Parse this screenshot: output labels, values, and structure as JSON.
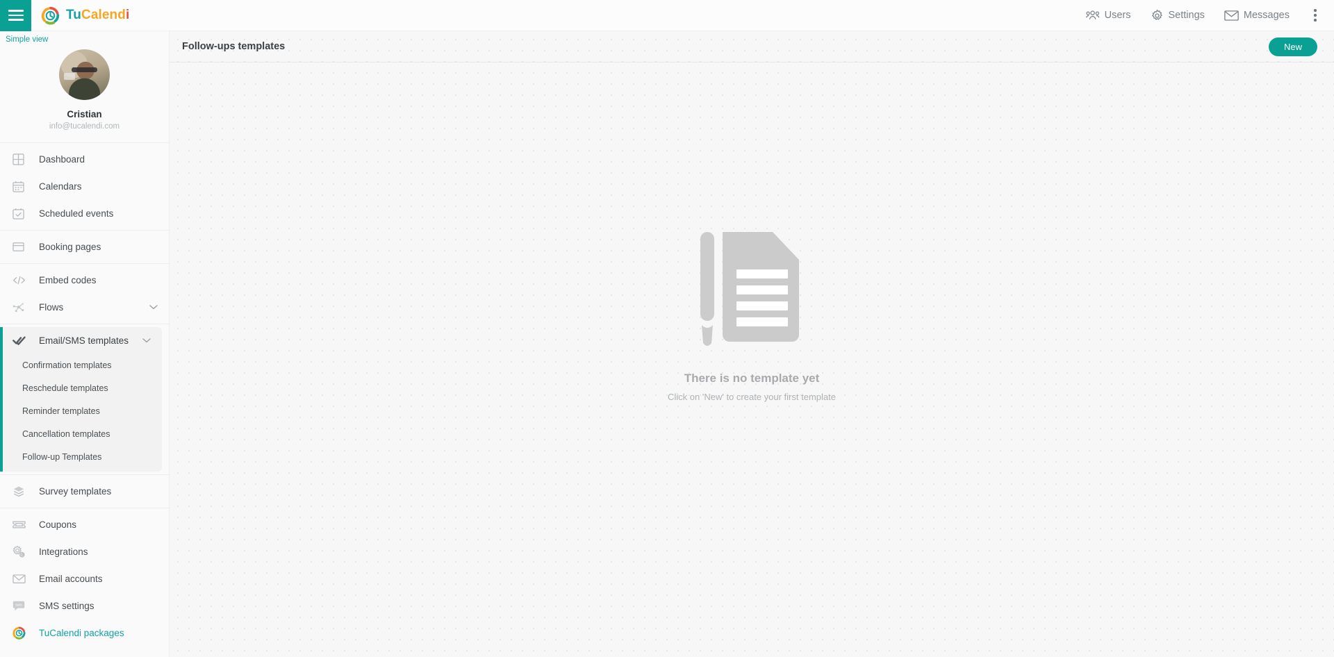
{
  "brand": {
    "name_part1": "Tu",
    "name_part2": "Calend",
    "name_part3": "i",
    "teal": "#13a2a0",
    "orange": "#f5a623",
    "red": "#e8533f",
    "accent": "#0aa194"
  },
  "topbar": {
    "menu_icon": "hamburger-icon",
    "actions": [
      {
        "label": "Users",
        "icon": "users-icon"
      },
      {
        "label": "Settings",
        "icon": "gear-icon"
      },
      {
        "label": "Messages",
        "icon": "envelope-icon"
      }
    ],
    "overflow_icon": "kebab-menu-icon"
  },
  "sidebar": {
    "simple_view": "Simple view",
    "profile": {
      "name": "Cristian",
      "email": "info@tucalendi.com",
      "avatar": "user-avatar"
    },
    "groups": [
      {
        "items": [
          {
            "label": "Dashboard",
            "icon": "dashboard-grid-icon"
          },
          {
            "label": "Calendars",
            "icon": "calendar-icon"
          },
          {
            "label": "Scheduled events",
            "icon": "calendar-check-icon"
          }
        ]
      },
      {
        "items": [
          {
            "label": "Booking pages",
            "icon": "window-icon"
          }
        ]
      },
      {
        "items": [
          {
            "label": "Embed codes",
            "icon": "code-icon"
          },
          {
            "label": "Flows",
            "icon": "flow-nodes-icon",
            "chevron": true
          }
        ]
      }
    ],
    "active_group": {
      "label": "Email/SMS templates",
      "icon": "double-check-icon",
      "chevron": true,
      "subitems": [
        {
          "label": "Confirmation templates"
        },
        {
          "label": "Reschedule templates"
        },
        {
          "label": "Reminder templates"
        },
        {
          "label": "Cancellation templates"
        },
        {
          "label": "Follow-up Templates"
        }
      ]
    },
    "groups_bottom": [
      {
        "items": [
          {
            "label": "Survey templates",
            "icon": "layers-icon"
          }
        ]
      },
      {
        "items": [
          {
            "label": "Coupons",
            "icon": "ticket-icon"
          },
          {
            "label": "Integrations",
            "icon": "gears-icon"
          },
          {
            "label": "Email accounts",
            "icon": "envelope-icon"
          },
          {
            "label": "SMS settings",
            "icon": "sms-bubble-icon"
          },
          {
            "label": "TuCalendi packages",
            "icon": "tucalendi-logo-icon",
            "accent": true
          }
        ]
      }
    ]
  },
  "main": {
    "page_title": "Follow-ups templates",
    "new_button": "New",
    "empty_state": {
      "illustration": "document-with-pencil-icon",
      "title": "There is no template yet",
      "subtitle": "Click on 'New' to create your first template"
    }
  }
}
